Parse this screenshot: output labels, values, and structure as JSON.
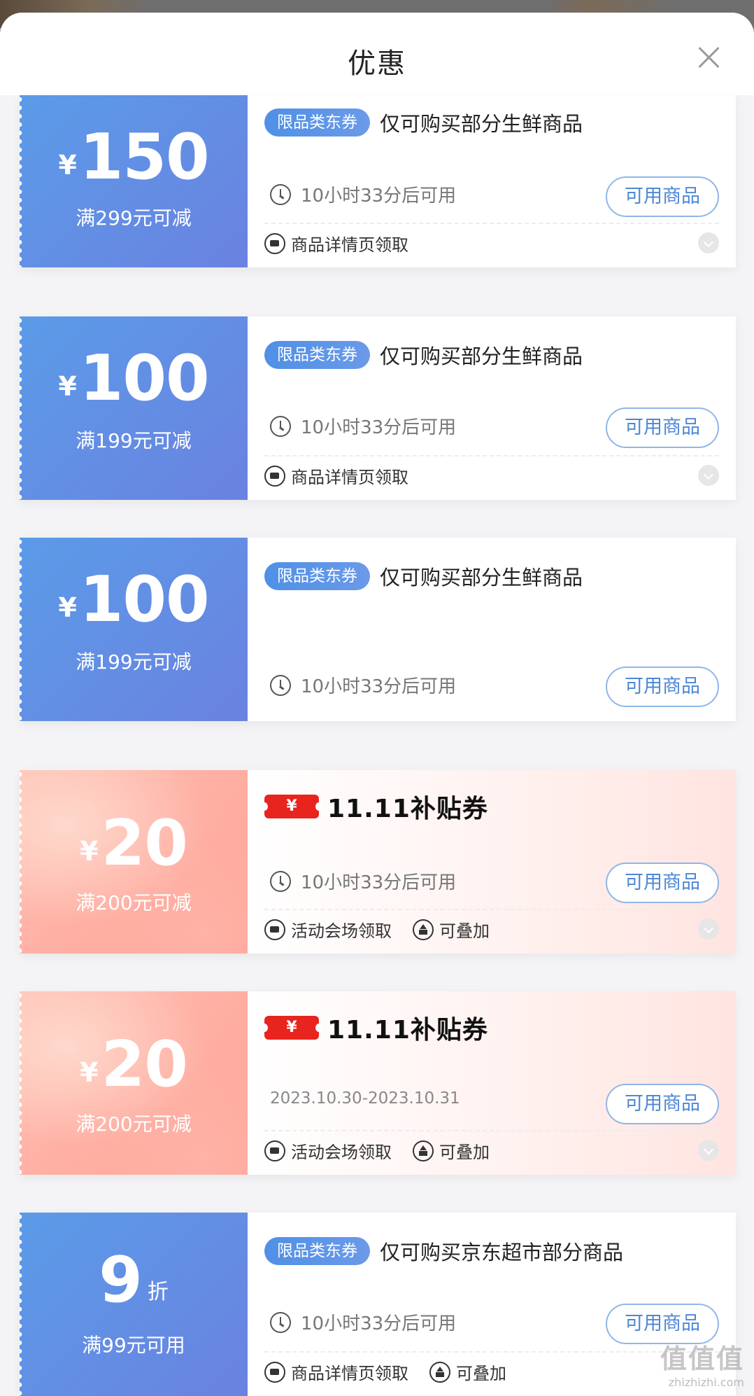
{
  "sheet": {
    "title": "优惠",
    "close_label": "×"
  },
  "coupons": [
    {
      "style": "blue",
      "currency": "¥",
      "amount": "150",
      "condition": "满299元可减",
      "tag": "限品类东券",
      "description": "仅可购买部分生鲜商品",
      "time": "10小时33分后可用",
      "button": "可用商品",
      "meta": [
        "商品详情页领取"
      ]
    },
    {
      "style": "blue",
      "currency": "¥",
      "amount": "100",
      "condition": "满199元可减",
      "tag": "限品类东券",
      "description": "仅可购买部分生鲜商品",
      "time": "10小时33分后可用",
      "button": "可用商品",
      "meta": [
        "商品详情页领取"
      ]
    },
    {
      "style": "blue",
      "currency": "¥",
      "amount": "100",
      "condition": "满199元可减",
      "tag": "限品类东券",
      "description": "仅可购买部分生鲜商品",
      "time": "10小时33分后可用",
      "button": "可用商品",
      "meta": []
    },
    {
      "style": "pink",
      "currency": "¥",
      "amount": "20",
      "condition": "满200元可减",
      "badge": "¥",
      "subsidy_title": "11.11补贴券",
      "time": "10小时33分后可用",
      "button": "可用商品",
      "meta": [
        "活动会场领取",
        "可叠加"
      ]
    },
    {
      "style": "pink",
      "currency": "¥",
      "amount": "20",
      "condition": "满200元可减",
      "badge": "¥",
      "subsidy_title": "11.11补贴券",
      "date": "2023.10.30-2023.10.31",
      "button": "可用商品",
      "meta": [
        "活动会场领取",
        "可叠加"
      ]
    },
    {
      "style": "blue",
      "amount": "9",
      "amount_unit": "折",
      "condition": "满99元可用",
      "tag": "限品类东券",
      "description": "仅可购买京东超市部分商品",
      "time": "10小时33分后可用",
      "button": "可用商品",
      "meta": [
        "商品详情页领取",
        "可叠加"
      ]
    }
  ],
  "watermark": {
    "main": "值值值",
    "sub": "zhizhizhi.com"
  },
  "colors": {
    "blue_accent": "#5b9be8",
    "pink_accent": "#ff9e93",
    "button_text": "#4d87d6",
    "subsidy_red": "#e8241e"
  }
}
